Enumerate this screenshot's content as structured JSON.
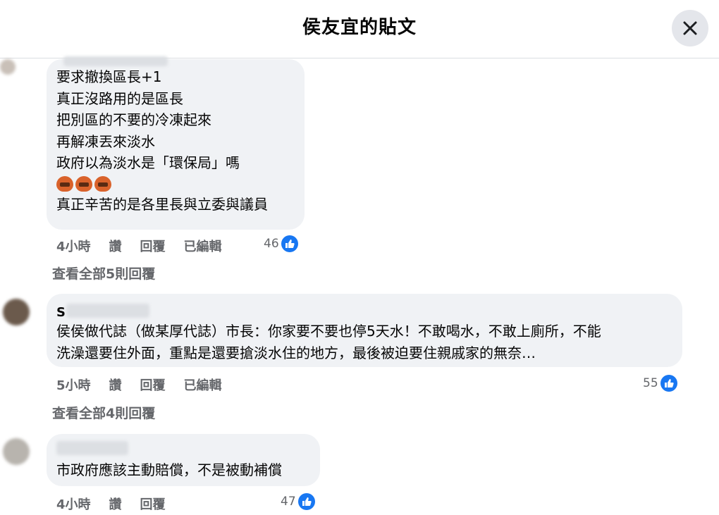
{
  "header": {
    "title": "侯友宜的貼文"
  },
  "comments": [
    {
      "author_initial": "",
      "lines": [
        "要求撤換區長+1",
        "真正沒路用的是區長",
        "把別區的不要的冷凍起來",
        "再解凍丟來淡水",
        "政府以為淡水是「環保局」嗎"
      ],
      "emoji_count": 3,
      "last_line": "真正辛苦的是各里長與立委與議員",
      "time": "4小時",
      "like_label": "讚",
      "reply_label": "回覆",
      "edited_label": "已編輯",
      "likes": "46",
      "view_replies": "查看全部5則回覆"
    },
    {
      "author_initial": "S",
      "lines": [
        "侯侯做代誌（做某厚代誌）市長：你家要不要也停5天水！不敢喝水，不敢上廁所，不能",
        "洗澡還要住外面，重點是還要搶淡水住的地方，最後被迫要住親戚家的無奈…"
      ],
      "time": "5小時",
      "like_label": "讚",
      "reply_label": "回覆",
      "edited_label": "已編輯",
      "likes": "55",
      "view_replies": "查看全部4則回覆"
    },
    {
      "author_initial": "",
      "lines": [
        "市政府應該主動賠償，不是被動補償"
      ],
      "time": "4小時",
      "like_label": "讚",
      "reply_label": "回覆",
      "likes": "47"
    }
  ],
  "icons": {
    "close": "close-icon",
    "like": "thumbs-up-icon"
  },
  "colors": {
    "like_blue": "#1877f2",
    "bubble_bg": "#f0f2f5",
    "meta_gray": "#65676b"
  }
}
